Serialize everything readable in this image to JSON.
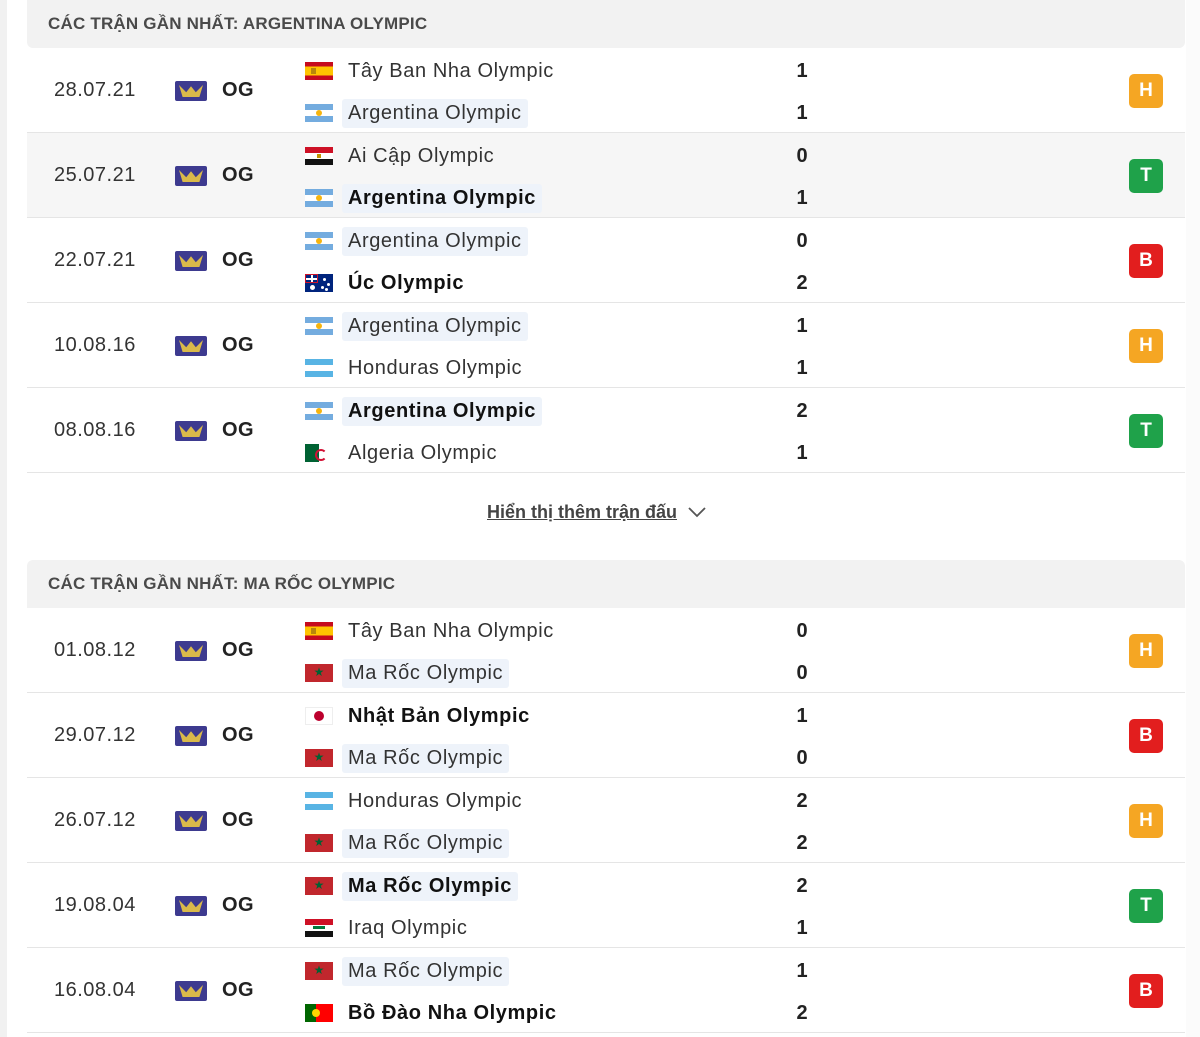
{
  "sections": [
    {
      "title": "CÁC TRẬN GẦN NHẤT: ARGENTINA OLYMPIC",
      "matches": [
        {
          "date": "28.07.21",
          "league": "OG",
          "home": {
            "name": "Tây Ban Nha Olympic",
            "flag": "spain-flag",
            "score": "1"
          },
          "away": {
            "name": "Argentina Olympic",
            "flag": "argentina-flag",
            "score": "1"
          },
          "result": "H",
          "result_color": "#f5a623"
        },
        {
          "date": "25.07.21",
          "league": "OG",
          "home": {
            "name": "Ai Cập Olympic",
            "flag": "egypt-flag",
            "score": "0"
          },
          "away": {
            "name": "Argentina Olympic",
            "flag": "argentina-flag",
            "score": "1"
          },
          "result": "T",
          "result_color": "#1fa24a"
        },
        {
          "date": "22.07.21",
          "league": "OG",
          "home": {
            "name": "Argentina Olympic",
            "flag": "argentina-flag",
            "score": "0"
          },
          "away": {
            "name": "Úc Olympic",
            "flag": "australia-flag",
            "score": "2"
          },
          "result": "B",
          "result_color": "#e21e1e"
        },
        {
          "date": "10.08.16",
          "league": "OG",
          "home": {
            "name": "Argentina Olympic",
            "flag": "argentina-flag",
            "score": "1"
          },
          "away": {
            "name": "Honduras Olympic",
            "flag": "honduras-flag",
            "score": "1"
          },
          "result": "H",
          "result_color": "#f5a623"
        },
        {
          "date": "08.08.16",
          "league": "OG",
          "home": {
            "name": "Argentina Olympic",
            "flag": "argentina-flag",
            "score": "2"
          },
          "away": {
            "name": "Algeria Olympic",
            "flag": "algeria-flag",
            "score": "1"
          },
          "result": "T",
          "result_color": "#1fa24a"
        }
      ],
      "show_more_label": "Hiển thị thêm trận đấu"
    },
    {
      "title": "CÁC TRẬN GẦN NHẤT: MA RỐC OLYMPIC",
      "matches": [
        {
          "date": "01.08.12",
          "league": "OG",
          "home": {
            "name": "Tây Ban Nha Olympic",
            "flag": "spain-flag",
            "score": "0"
          },
          "away": {
            "name": "Ma Rốc Olympic",
            "flag": "morocco-flag",
            "score": "0"
          },
          "result": "H",
          "result_color": "#f5a623"
        },
        {
          "date": "29.07.12",
          "league": "OG",
          "home": {
            "name": "Nhật Bản Olympic",
            "flag": "japan-flag",
            "score": "1"
          },
          "away": {
            "name": "Ma Rốc Olympic",
            "flag": "morocco-flag",
            "score": "0"
          },
          "result": "B",
          "result_color": "#e21e1e"
        },
        {
          "date": "26.07.12",
          "league": "OG",
          "home": {
            "name": "Honduras Olympic",
            "flag": "honduras-flag",
            "score": "2"
          },
          "away": {
            "name": "Ma Rốc Olympic",
            "flag": "morocco-flag",
            "score": "2"
          },
          "result": "H",
          "result_color": "#f5a623"
        },
        {
          "date": "19.08.04",
          "league": "OG",
          "home": {
            "name": "Ma Rốc Olympic",
            "flag": "morocco-flag",
            "score": "2"
          },
          "away": {
            "name": "Iraq Olympic",
            "flag": "iraq-flag",
            "score": "1"
          },
          "result": "T",
          "result_color": "#1fa24a"
        },
        {
          "date": "16.08.04",
          "league": "OG",
          "home": {
            "name": "Ma Rốc Olympic",
            "flag": "morocco-flag",
            "score": "1"
          },
          "away": {
            "name": "Bồ Đào Nha Olympic",
            "flag": "portugal-flag",
            "score": "2"
          },
          "result": "B",
          "result_color": "#e21e1e"
        }
      ]
    }
  ],
  "league_icon": "olympic-games-icon",
  "chevron_icon": "chevron-down-icon"
}
